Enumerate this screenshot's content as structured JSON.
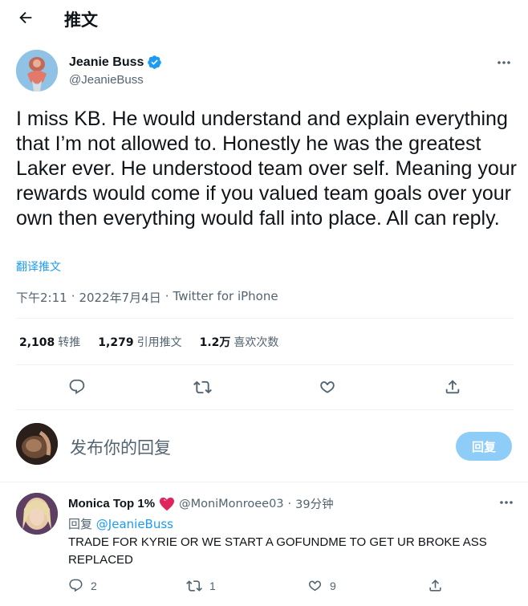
{
  "header": {
    "title": "推文",
    "back_icon": "arrow-left-icon"
  },
  "author": {
    "name": "Jeanie Buss",
    "handle": "@JeanieBuss",
    "verified": true
  },
  "tweet": {
    "text": "I miss KB. He would understand and explain everything that I’m not allowed to. Honestly he was the greatest Laker ever. He understood team over self. Meaning your rewards would come if you valued team goals over your own then everything would fall into place. All can reply.",
    "translate_label": "翻译推文",
    "time": "下午2:11",
    "date": "2022年7月4日",
    "source": "Twitter for iPhone",
    "separator": "·"
  },
  "stats": {
    "retweets_value": "2,108",
    "retweets_label": "转推",
    "quotes_value": "1,279",
    "quotes_label": "引用推文",
    "likes_value": "1.2万",
    "likes_label": "喜欢次数"
  },
  "compose": {
    "placeholder": "发布你的回复",
    "reply_button": "回复"
  },
  "reply": {
    "name": "Monica Top 1%",
    "handle": "@MoniMonroee03",
    "separator": "·",
    "time": "39分钟",
    "reply_to_label": "回复",
    "reply_to_handle": "@JeanieBuss",
    "text": "TRADE FOR KYRIE OR WE START A GOFUNDME TO GET UR BROKE ASS REPLACED",
    "replies": "2",
    "retweets": "1",
    "likes": "9"
  },
  "colors": {
    "accent": "#1d9bf0",
    "text": "#0f1419",
    "secondary": "#536471",
    "reply_button_disabled": "#8ecdf8",
    "heart_emoji": "#e0245e"
  }
}
